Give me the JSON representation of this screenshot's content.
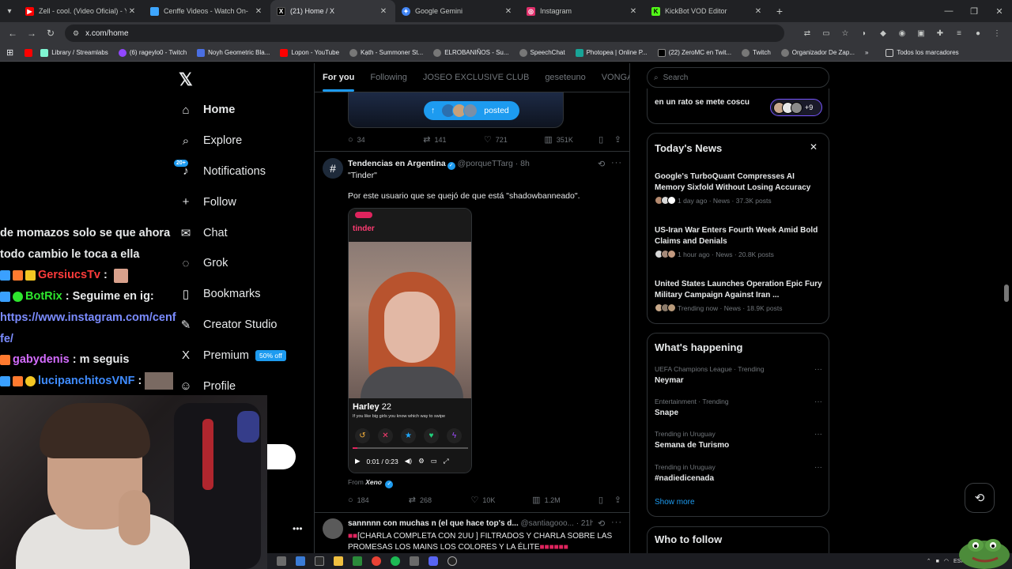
{
  "browser": {
    "tabs": [
      {
        "title": "Zell - cool. (Video Oficial) - You",
        "color": "#ff0000"
      },
      {
        "title": "Cenffe Videos - Watch On-",
        "color": "#3ea6ff"
      },
      {
        "title": "(21) Home / X",
        "color": "#000000"
      },
      {
        "title": "Google Gemini",
        "color": "#4285f4"
      },
      {
        "title": "Instagram",
        "color": "#e1306c"
      },
      {
        "title": "KickBot VOD Editor",
        "color": "#53fc18"
      }
    ],
    "url": "x.com/home",
    "bookmarks": [
      {
        "label": "Library / Streamlabs",
        "color": "#80f5d2"
      },
      {
        "label": "(6) rageylo0 - Twitch",
        "color": "#9147ff"
      },
      {
        "label": "Noyh Geometric Bla...",
        "color": "#4a6fe3"
      },
      {
        "label": "Lopon - YouTube",
        "color": "#ff0000"
      },
      {
        "label": "Kạth - Summoner St...",
        "color": "#888888"
      },
      {
        "label": "ELROBANIÑOS - Su...",
        "color": "#888888"
      },
      {
        "label": "SpeechChat",
        "color": "#888888"
      },
      {
        "label": "Photopea | Online P...",
        "color": "#18a497"
      },
      {
        "label": "(22) ZeroMC en Twit...",
        "color": "#000000"
      },
      {
        "label": "Twitch",
        "color": "#888888"
      },
      {
        "label": "Organizador De Zap...",
        "color": "#888888"
      }
    ],
    "all_bookmarks": "Todos los marcadores"
  },
  "sidebar": {
    "items": [
      {
        "label": "Home",
        "icon": "⌂",
        "bold": true
      },
      {
        "label": "Explore",
        "icon": "⌕"
      },
      {
        "label": "Notifications",
        "icon": "♪",
        "badge": "20+"
      },
      {
        "label": "Follow",
        "icon": "+"
      },
      {
        "label": "Chat",
        "icon": "✉"
      },
      {
        "label": "Grok",
        "icon": "◌"
      },
      {
        "label": "Bookmarks",
        "icon": "▯"
      },
      {
        "label": "Creator Studio",
        "icon": "✎"
      },
      {
        "label": "Premium",
        "icon": "X",
        "tag": "50% off"
      },
      {
        "label": "Profile",
        "icon": "☺"
      }
    ]
  },
  "stream_chat": {
    "lines": [
      {
        "text": "de momazos solo se que ahora",
        "color": "#ffffff"
      },
      {
        "text": "todo cambio le toca a ella",
        "color": "#ffffff"
      },
      {
        "user": "GersiucsTv",
        "suffix": " :",
        "color": "#ff3b3b"
      },
      {
        "user": "BotRix",
        "suffix": " : Seguime en ig:",
        "color": "#2ee62e"
      },
      {
        "text": "https://www.instagram.com/cenf",
        "color": "#7b8cff"
      },
      {
        "text": "fe/",
        "color": "#7b8cff"
      },
      {
        "user": "gabydenis",
        "suffix": " : m seguis",
        "color": "#d46cff"
      },
      {
        "user": "lucipanchitosVNF",
        "suffix": " :",
        "color": "#3f8cff"
      }
    ]
  },
  "feed": {
    "tabs": [
      "For you",
      "Following",
      "JOSEO EXCLUSIVE CLUB",
      "geseteuno",
      "VONGANG"
    ],
    "posted_label": "posted",
    "post1_stats": {
      "replies": "34",
      "reposts": "141",
      "likes": "721",
      "views": "351K"
    },
    "post2": {
      "name": "Tendencias en Argentina",
      "handle": "@porqueTTarg · 8h",
      "quote": "\"Tinder\"",
      "body": "Por este usuario que se quejó de que está \"shadowbanneado\".",
      "video": {
        "app": "tinder",
        "profile_name": "Harley",
        "age": "22",
        "tagline": "If you like big girls you know which way to swipe",
        "time": "0:01 / 0:23",
        "progress": 0.04
      },
      "from_label": "From",
      "from_user": "Xeno",
      "stats": {
        "replies": "184",
        "reposts": "268",
        "likes": "10K",
        "views": "1.2M"
      }
    },
    "post3": {
      "name": "sannnnn con muchas n (el que hace top's d...",
      "handle": "@santiagooo...",
      "time": "· 21h",
      "body": "[CHARLA COMPLETA CON 2UU ] FILTRADOS Y CHARLA SOBRE LAS PROMESAS LOS MAINS LOS COLORES Y LA ÉLITE"
    }
  },
  "right": {
    "search_placeholder": "Search",
    "card0_text": "en un rato se mete coscu",
    "card0_count": "+9",
    "todays_news": {
      "title": "Today's News",
      "items": [
        {
          "title": "Google's TurboQuant Compresses AI Memory Sixfold Without Losing Accuracy",
          "meta": "1 day ago · News · 37.3K posts"
        },
        {
          "title": "US-Iran War Enters Fourth Week Amid Bold Claims and Denials",
          "meta": "1 hour ago · News · 20.8K posts"
        },
        {
          "title": "United States Launches Operation Epic Fury Military Campaign Against Iran ...",
          "meta": "Trending now · News · 18.9K posts"
        }
      ]
    },
    "whats_happening": {
      "title": "What's happening",
      "items": [
        {
          "context": "UEFA Champions League · Trending",
          "topic": "Neymar"
        },
        {
          "context": "Entertainment · Trending",
          "topic": "Snape"
        },
        {
          "context": "Trending in Uruguay",
          "topic": "Semana de Turismo"
        },
        {
          "context": "Trending in Uruguay",
          "topic": "#nadiedicenada"
        }
      ],
      "show_more": "Show more"
    },
    "who_to_follow": "Who to follow"
  },
  "taskbar": {
    "lang": "ESP"
  }
}
